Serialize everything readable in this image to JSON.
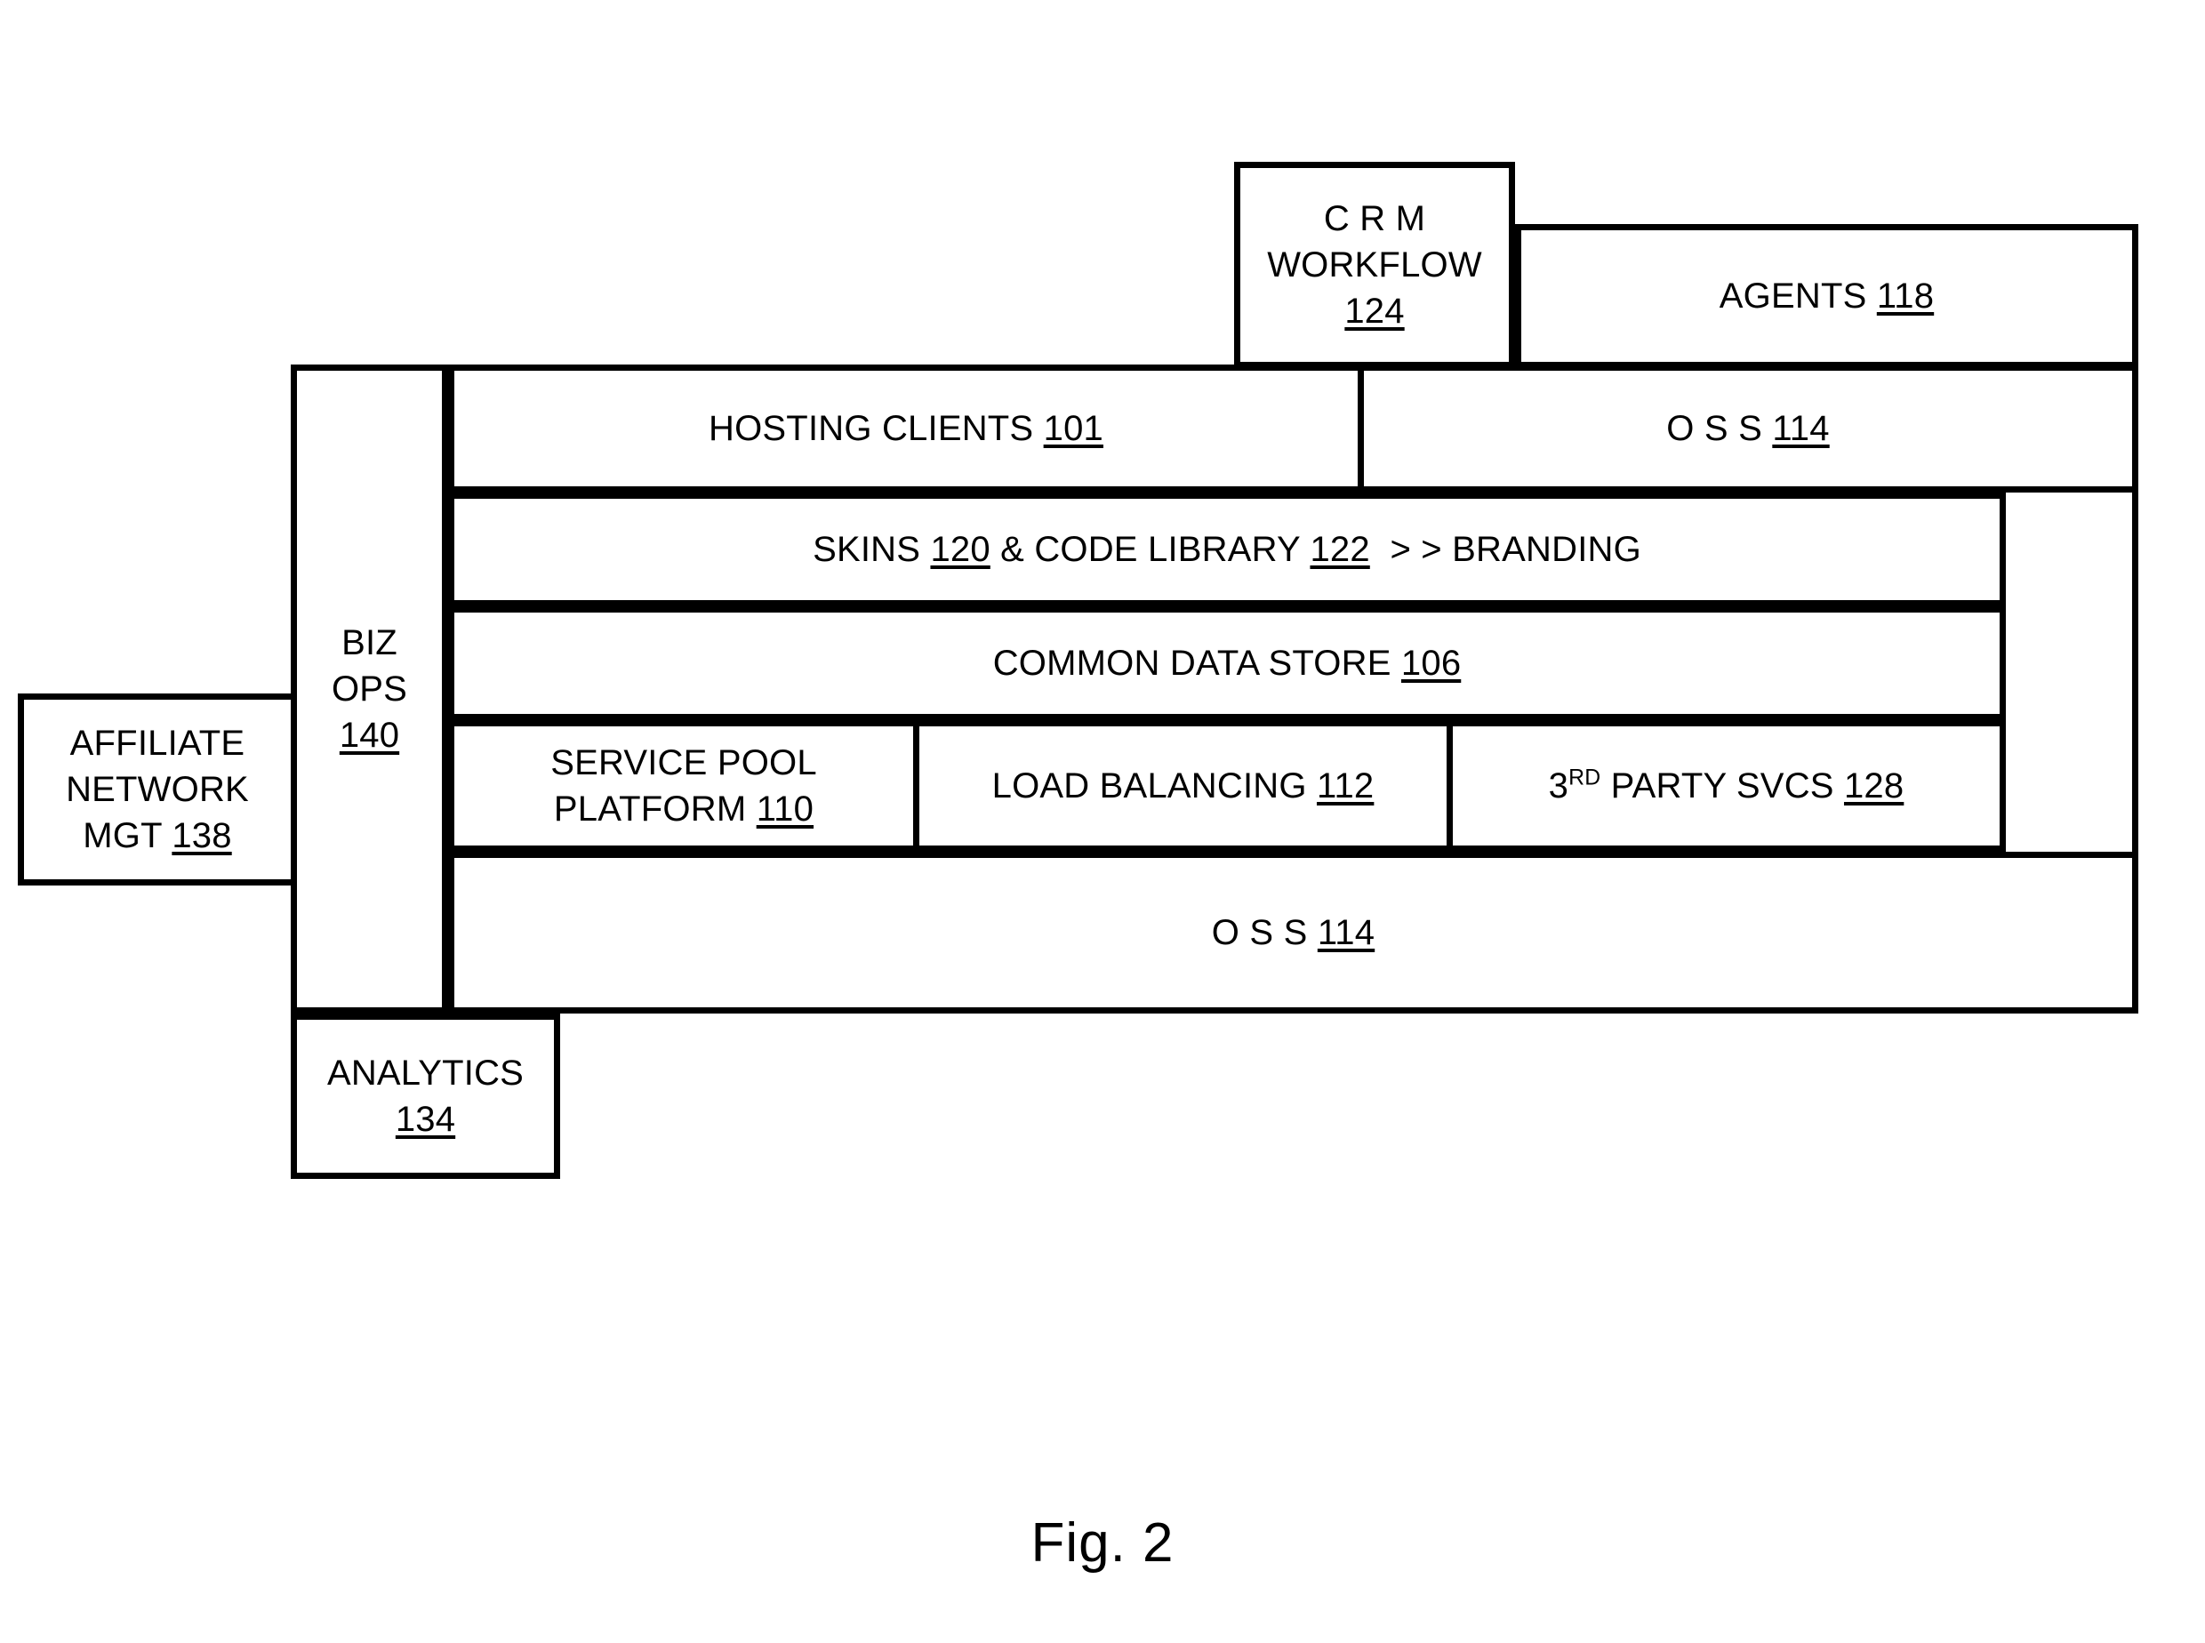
{
  "figure": {
    "caption": "Fig. 2"
  },
  "blocks": {
    "crm_workflow": {
      "line1": "C R M",
      "line2": "WORKFLOW",
      "ref": "124"
    },
    "agents": {
      "label": "AGENTS",
      "ref": "118"
    },
    "hosting_clients": {
      "label": "HOSTING CLIENTS",
      "ref": "101"
    },
    "oss_top": {
      "label": "O S S",
      "ref": "114"
    },
    "skins_row": {
      "part1": "SKINS",
      "ref1": "120",
      "part2": "& CODE LIBRARY",
      "ref2": "122",
      "part3": "> > BRANDING"
    },
    "common_data_store": {
      "label": "COMMON DATA STORE",
      "ref": "106"
    },
    "service_pool": {
      "line1": "SERVICE POOL",
      "line2": "PLATFORM",
      "ref": "110"
    },
    "load_balancing": {
      "label": "LOAD BALANCING",
      "ref": "112"
    },
    "third_party": {
      "prefix": "3",
      "ordinal": "RD",
      "label": "PARTY SVCS",
      "ref": "128"
    },
    "oss_bottom": {
      "label": "O S S",
      "ref": "114"
    },
    "biz_ops": {
      "line1": "BIZ",
      "line2": "OPS",
      "ref": "140"
    },
    "affiliate_network": {
      "line1": "AFFILIATE",
      "line2": "NETWORK",
      "line3": "MGT",
      "ref": "138"
    },
    "analytics": {
      "label": "ANALYTICS",
      "ref": "134"
    }
  },
  "colors": {
    "stroke": "#000000",
    "background": "#ffffff"
  }
}
